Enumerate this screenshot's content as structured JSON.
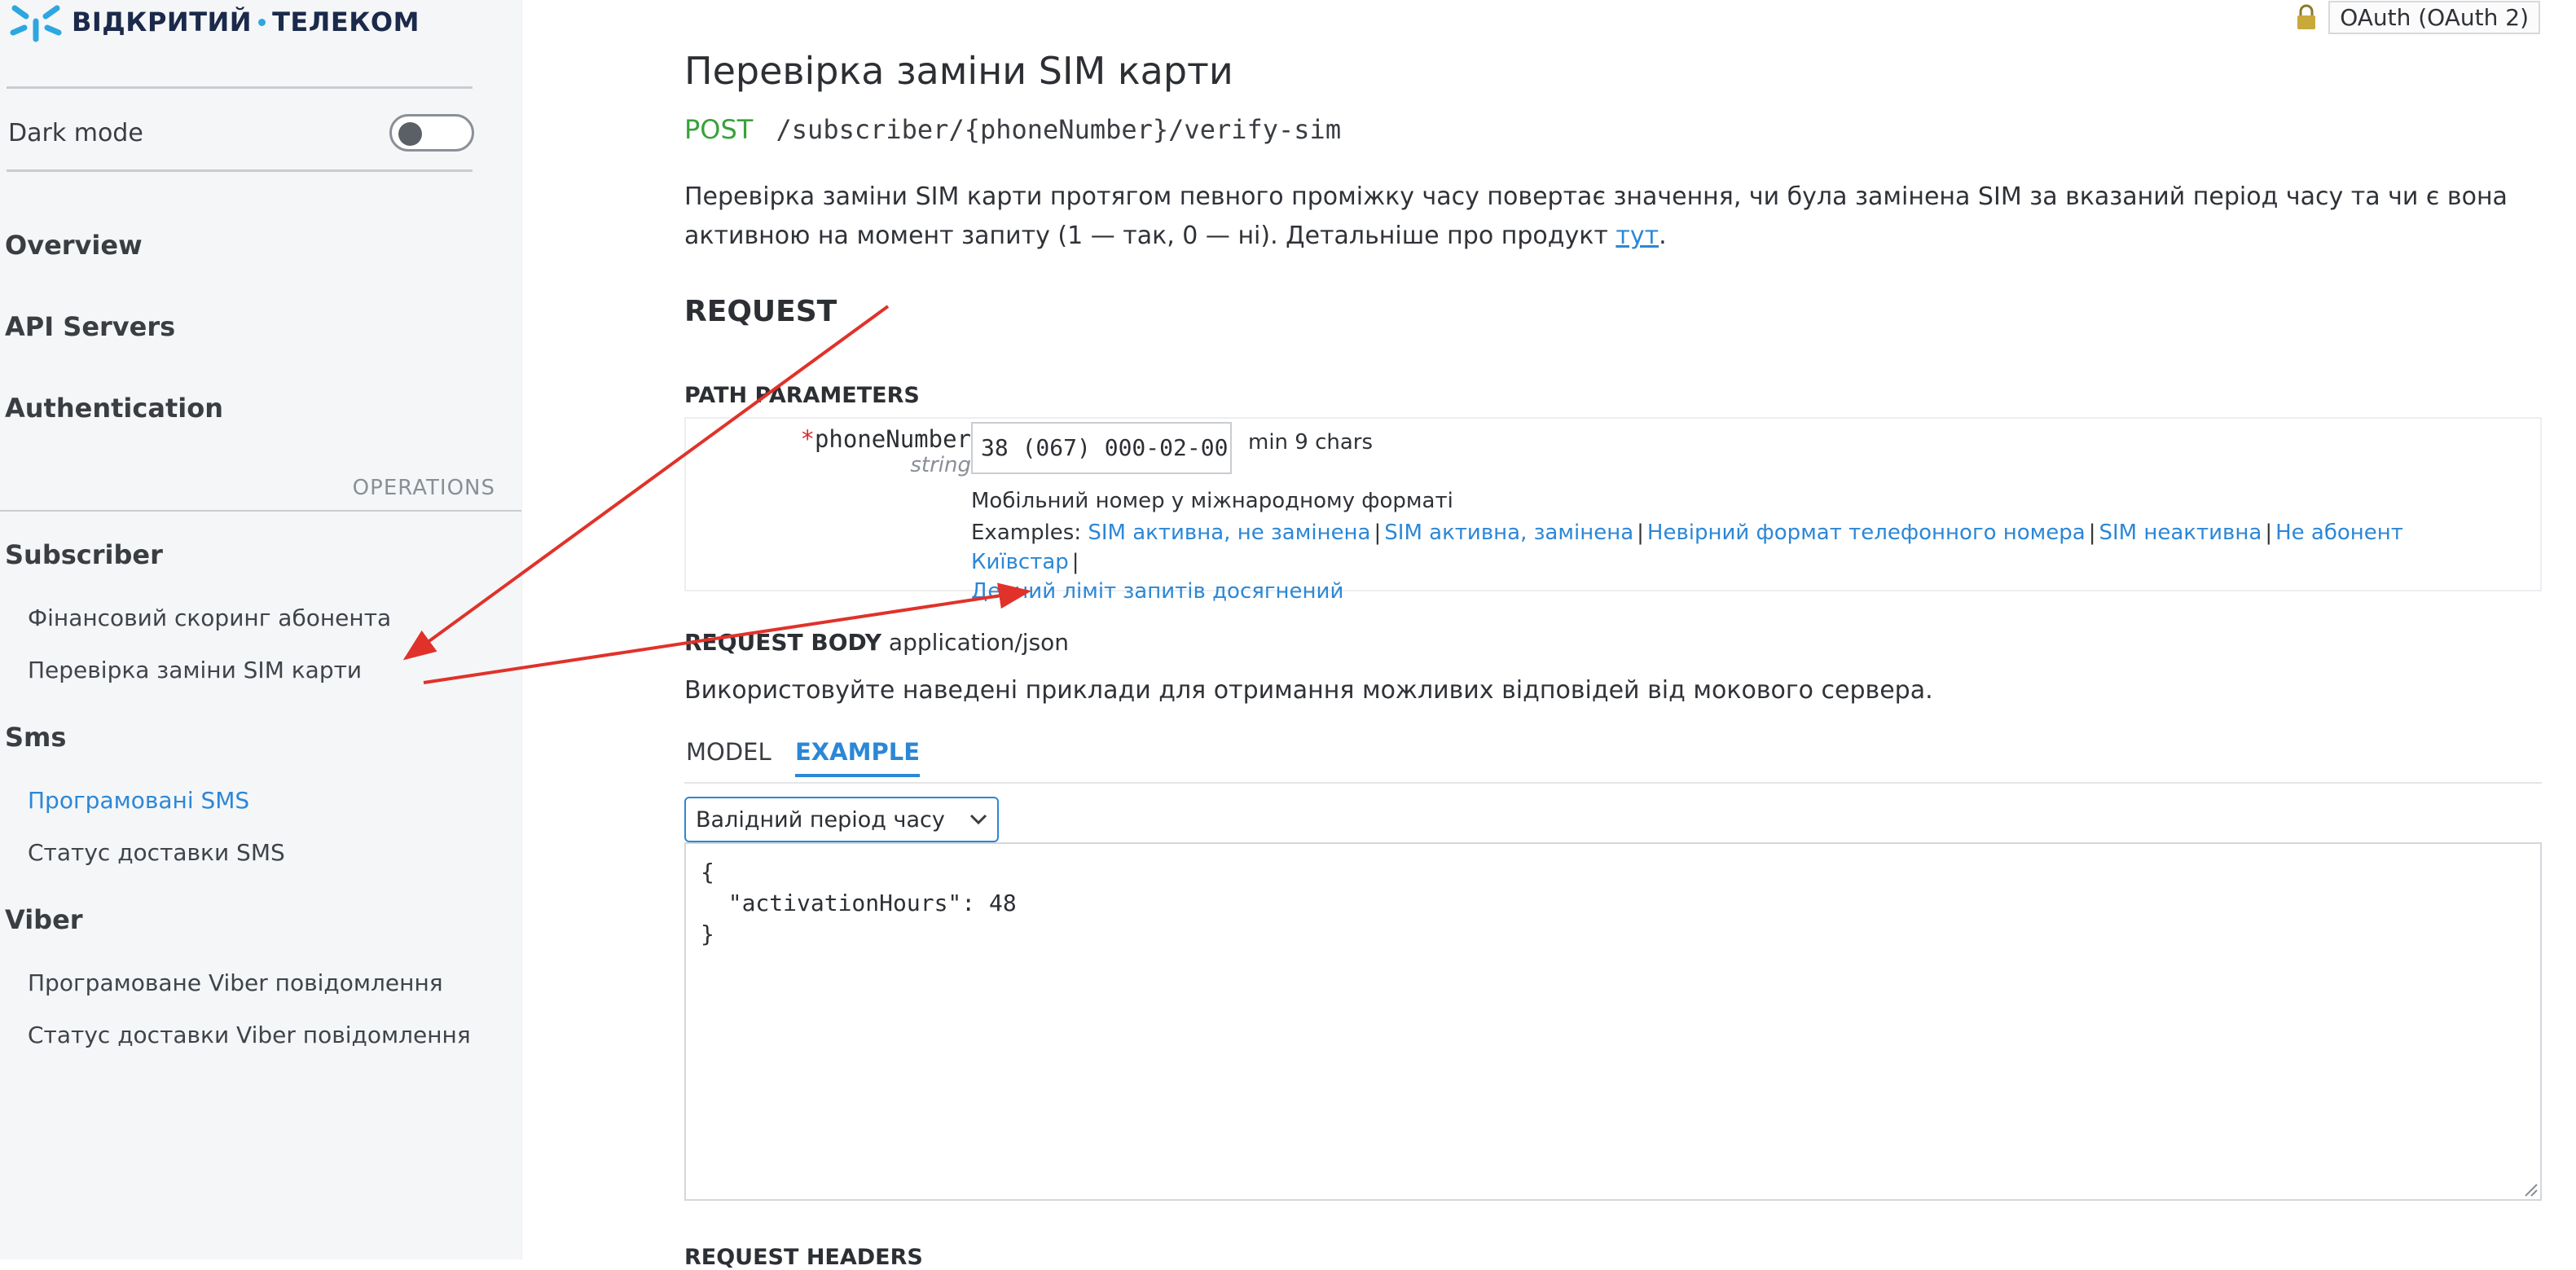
{
  "sidebar": {
    "logo_text_left": "ВІДКРИТИЙ",
    "logo_text_right": "ТЕЛЕКОМ",
    "dark_mode_label": "Dark mode",
    "nav": [
      {
        "label": "Overview"
      },
      {
        "label": "API Servers"
      },
      {
        "label": "Authentication"
      }
    ],
    "operations_label": "OPERATIONS",
    "groups": [
      {
        "label": "Subscriber",
        "items": [
          "Фінансовий скоринг абонента",
          "Перевірка заміни SIM карти"
        ]
      },
      {
        "label": "Sms",
        "items": [
          "Програмовані SMS",
          "Статус доставки SMS"
        ]
      },
      {
        "label": "Viber",
        "items": [
          "Програмоване Viber повідомлення",
          "Статус доставки Viber повідомлення"
        ]
      }
    ]
  },
  "header": {
    "auth_label": "OAuth (OAuth 2)"
  },
  "operation": {
    "title": "Перевірка заміни SIM карти",
    "method": "POST",
    "path": "/subscriber/{phoneNumber}/verify-sim",
    "description": "Перевірка заміни SIM карти протягом певного проміжку часу повертає значення, чи була замінена SIM за вказаний період часу та чи є вона активною на момент запиту (1 — так, 0 — ні). Детальніше про продукт ",
    "description_link": "тут",
    "description_end": "."
  },
  "request": {
    "heading": "REQUEST",
    "path_params_label": "PATH PARAMETERS",
    "param": {
      "required_mark": "*",
      "name": "phoneNumber",
      "type": "string",
      "value": "38 (067) 000-02-00",
      "constraint": "min 9 chars",
      "description": "Мобільний номер у міжнародному форматі",
      "examples_label": "Examples:",
      "examples": [
        "SIM активна, не замінена",
        "SIM активна, замінена",
        "Невірний формат телефонного номера",
        "SIM неактивна",
        "Не абонент Київстар",
        "Денний ліміт запитів досягнений"
      ]
    },
    "body_label": "REQUEST BODY",
    "body_content_type": "application/json",
    "body_description": "Використовуйте наведені приклади для отримання можливих відповідей від мокового сервера.",
    "tabs": [
      "MODEL",
      "EXAMPLE"
    ],
    "example_selected": "Валідний період часу",
    "example_code": "{\n  \"activationHours\": 48\n}",
    "headers_label": "REQUEST HEADERS"
  },
  "colors": {
    "accent": "#2c87d6",
    "post": "#3aa23a",
    "annotation_arrow": "#e0322a",
    "logo_blue": "#2da7e0"
  }
}
